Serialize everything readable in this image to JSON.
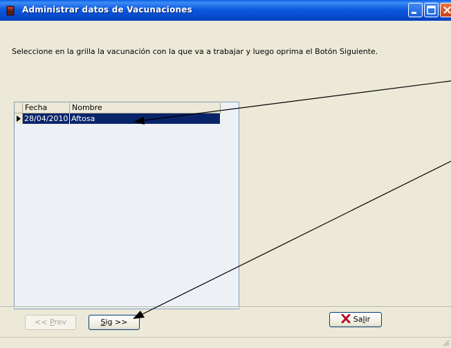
{
  "window": {
    "title": "Administrar datos de Vacunaciones"
  },
  "instructions": "Seleccione en la grilla la vacunación con la que va a trabajar y luego oprima el Botón Siguiente.",
  "grid": {
    "columns": [
      "Fecha",
      "Nombre"
    ],
    "rows": [
      {
        "fecha": "28/04/2010",
        "nombre": "Aftosa",
        "selected": true
      }
    ]
  },
  "buttons": {
    "prev": {
      "pre": "<< ",
      "mnemonic": "P",
      "rest": "rev",
      "enabled": false
    },
    "next": {
      "mnemonic": "S",
      "rest": "ig >>",
      "enabled": true
    },
    "exit": {
      "pre": "Sa",
      "mnemonic": "l",
      "rest": "ir",
      "icon": "red-x-icon"
    }
  },
  "colors": {
    "titlebar": "#0a5de6",
    "selection": "#0a246a",
    "arrow": "#000000"
  }
}
